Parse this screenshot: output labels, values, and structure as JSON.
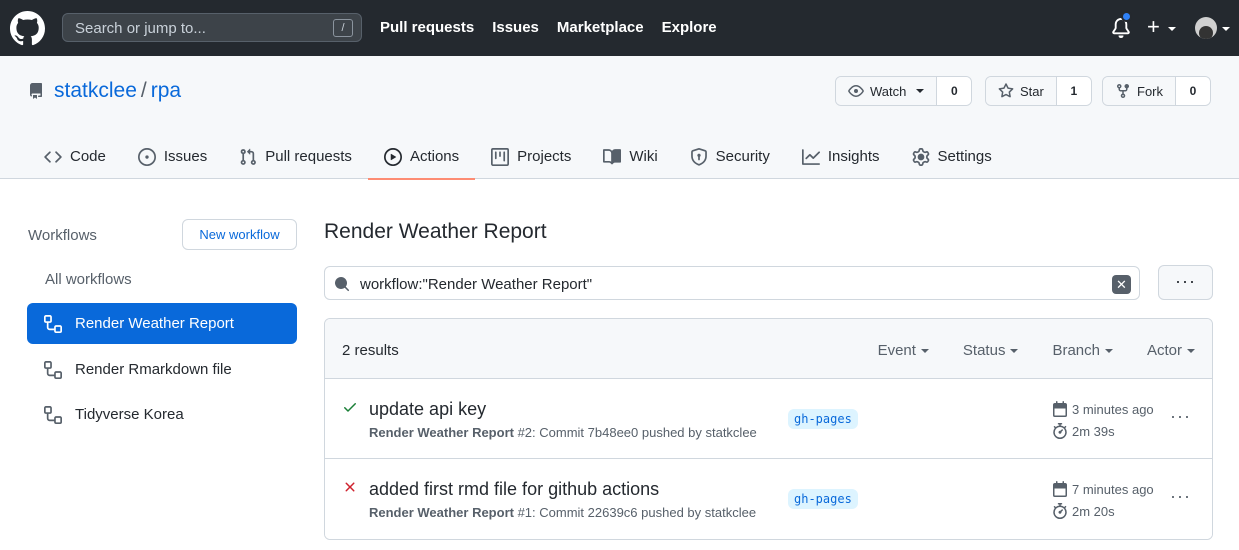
{
  "topbar": {
    "search_placeholder": "Search or jump to...",
    "search_shortcut": "/",
    "nav": [
      "Pull requests",
      "Issues",
      "Marketplace",
      "Explore"
    ]
  },
  "repo": {
    "owner": "statkclee",
    "separator": "/",
    "name": "rpa",
    "watch_label": "Watch",
    "watch_count": "0",
    "star_label": "Star",
    "star_count": "1",
    "fork_label": "Fork",
    "fork_count": "0"
  },
  "tabs": [
    {
      "label": "Code",
      "icon": "code-icon"
    },
    {
      "label": "Issues",
      "icon": "issue-icon"
    },
    {
      "label": "Pull requests",
      "icon": "pull-request-icon"
    },
    {
      "label": "Actions",
      "icon": "play-icon",
      "active": true
    },
    {
      "label": "Projects",
      "icon": "project-icon"
    },
    {
      "label": "Wiki",
      "icon": "book-icon"
    },
    {
      "label": "Security",
      "icon": "shield-icon"
    },
    {
      "label": "Insights",
      "icon": "graph-icon"
    },
    {
      "label": "Settings",
      "icon": "gear-icon"
    }
  ],
  "sidebar": {
    "title": "Workflows",
    "new_workflow": "New workflow",
    "all_workflows": "All workflows",
    "items": [
      {
        "label": "Render Weather Report",
        "active": true
      },
      {
        "label": "Render Rmarkdown file"
      },
      {
        "label": "Tidyverse Korea"
      }
    ]
  },
  "main": {
    "title": "Render Weather Report",
    "filter_value": "workflow:\"Render Weather Report\"",
    "more": "···",
    "results_count": "2 results",
    "filters": [
      "Event",
      "Status",
      "Branch",
      "Actor"
    ],
    "runs": [
      {
        "status": "success",
        "title": "update api key",
        "workflow": "Render Weather Report",
        "detail": " #2: Commit 7b48ee0 pushed by statkclee",
        "branch": "gh-pages",
        "when": "3 minutes ago",
        "duration": "2m 39s"
      },
      {
        "status": "failure",
        "title": "added first rmd file for github actions",
        "workflow": "Render Weather Report",
        "detail": " #1: Commit 22639c6 pushed by statkclee",
        "branch": "gh-pages",
        "when": "7 minutes ago",
        "duration": "2m 20s"
      }
    ]
  },
  "colors": {
    "header_bg": "#24292f",
    "accent": "#0969da",
    "success": "#1a7f37",
    "failure": "#cf222e",
    "tab_underline": "#fd8c73"
  }
}
